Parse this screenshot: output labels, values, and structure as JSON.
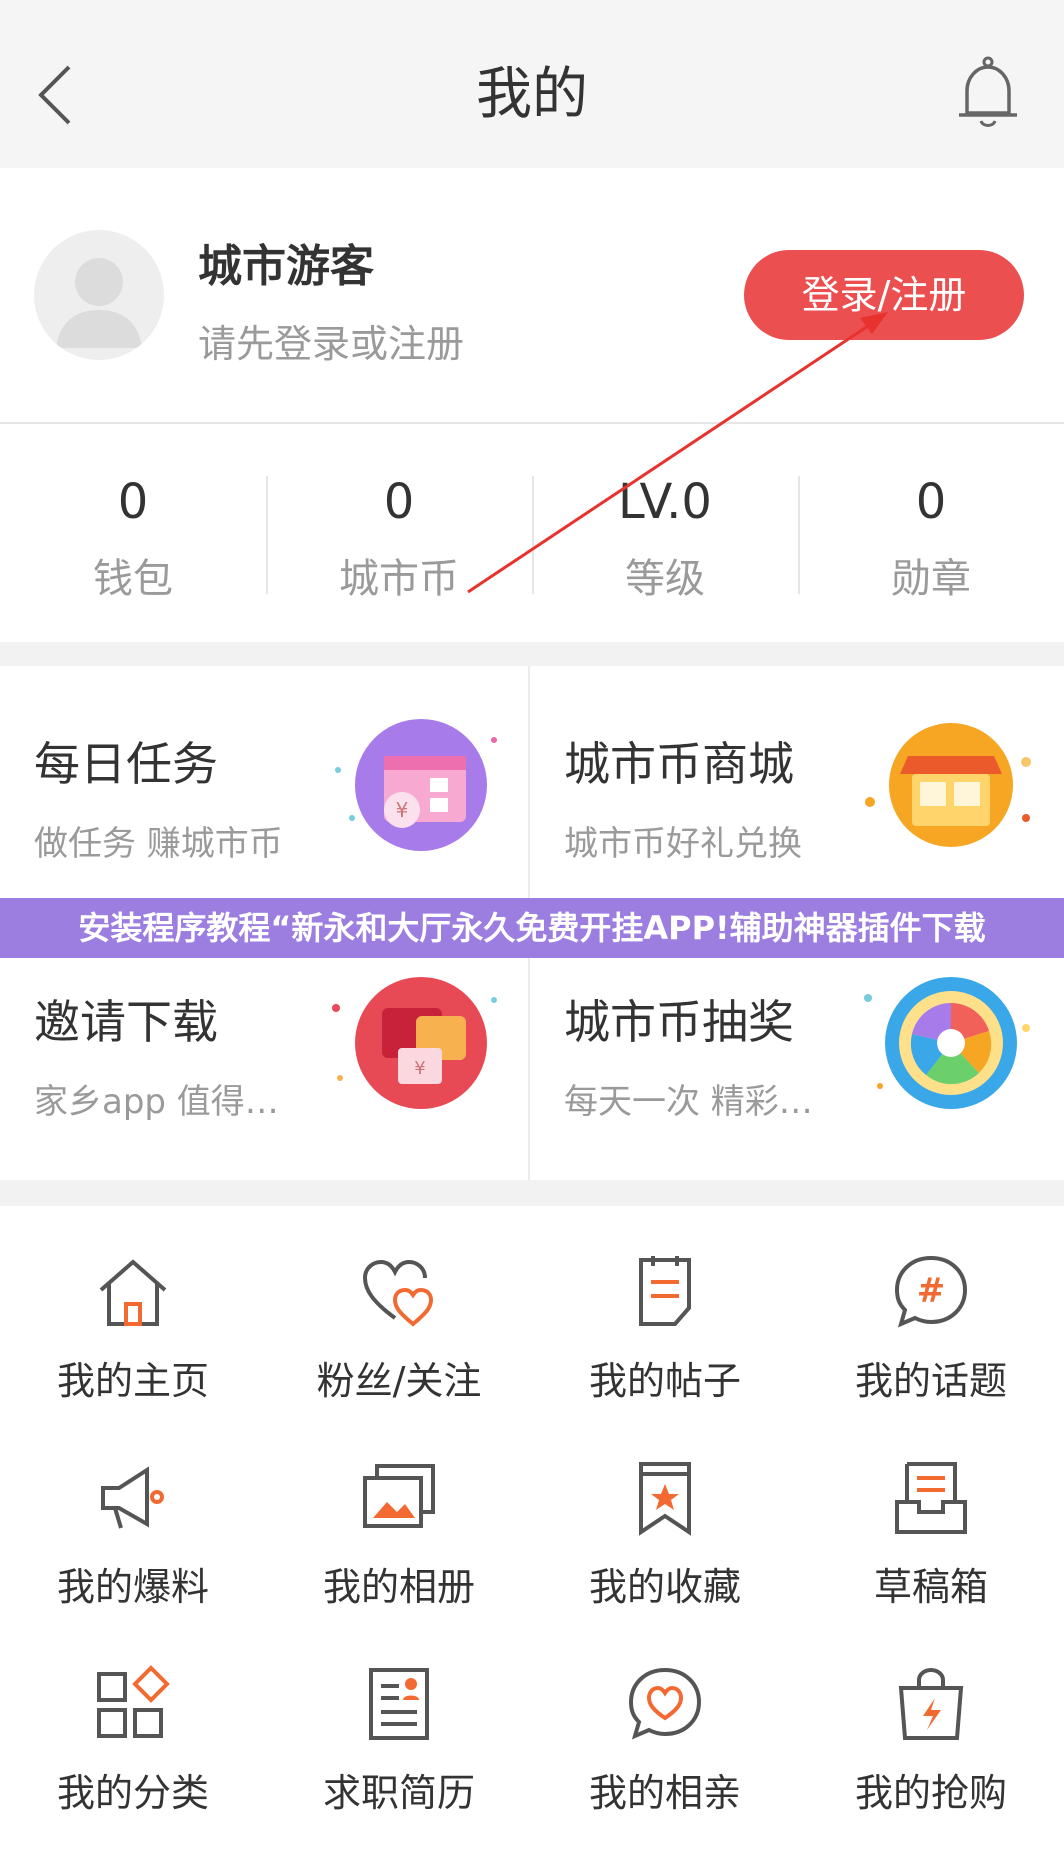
{
  "header": {
    "title": "我的",
    "back_icon": "chevron-left-icon",
    "bell_icon": "bell-icon"
  },
  "profile": {
    "name": "城市游客",
    "hint": "请先登录或注册",
    "login_label": "登录/注册",
    "accent": "#ec4f4f"
  },
  "stats": [
    {
      "value": "0",
      "label": "钱包"
    },
    {
      "value": "0",
      "label": "城市币"
    },
    {
      "value": "LV.0",
      "label": "等级"
    },
    {
      "value": "0",
      "label": "勋章"
    }
  ],
  "cards": [
    {
      "title": "每日任务",
      "subtitle": "做任务 赚城市币",
      "icon": "task-calendar-icon"
    },
    {
      "title": "城市币商城",
      "subtitle": "城市币好礼兑换",
      "icon": "shop-icon"
    },
    {
      "title": "邀请下载",
      "subtitle": "家乡app 值得…",
      "icon": "red-envelope-icon"
    },
    {
      "title": "城市币抽奖",
      "subtitle": "每天一次 精彩…",
      "icon": "lottery-wheel-icon"
    }
  ],
  "banner": {
    "text": "安装程序教程“新永和大厅永久免费开挂APP!辅助神器插件下载"
  },
  "grid": [
    {
      "label": "我的主页",
      "icon": "home-icon"
    },
    {
      "label": "粉丝/关注",
      "icon": "hearts-icon"
    },
    {
      "label": "我的帖子",
      "icon": "post-icon"
    },
    {
      "label": "我的话题",
      "icon": "hashtag-icon"
    },
    {
      "label": "我的爆料",
      "icon": "megaphone-icon"
    },
    {
      "label": "我的相册",
      "icon": "album-icon"
    },
    {
      "label": "我的收藏",
      "icon": "bookmark-icon"
    },
    {
      "label": "草稿箱",
      "icon": "drafts-icon"
    },
    {
      "label": "我的分类",
      "icon": "category-icon"
    },
    {
      "label": "求职简历",
      "icon": "resume-icon"
    },
    {
      "label": "我的相亲",
      "icon": "dating-icon"
    },
    {
      "label": "我的抢购",
      "icon": "flash-sale-icon"
    }
  ]
}
